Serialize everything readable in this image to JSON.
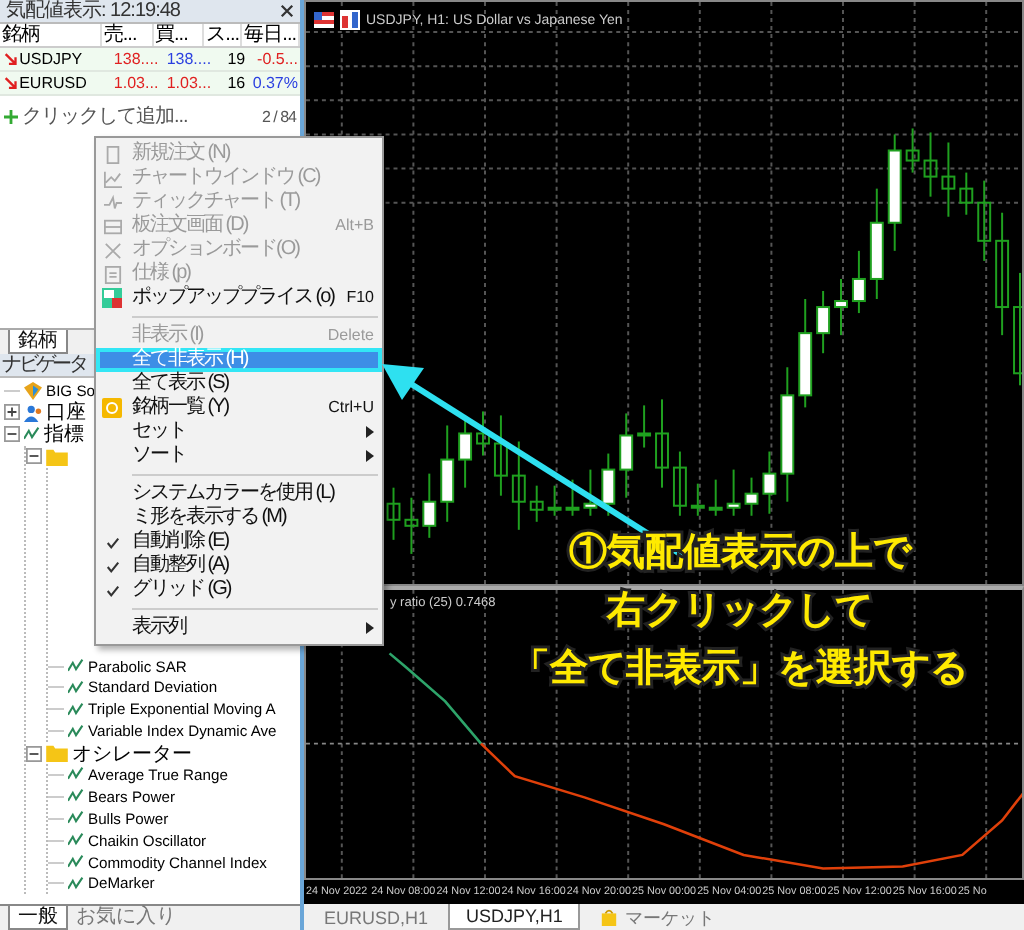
{
  "market_watch": {
    "title": "気配値表示: 12:19:48",
    "columns": [
      "銘柄",
      "売...",
      "買...",
      "ス...",
      "毎日..."
    ],
    "rows": [
      {
        "symbol": "USDJPY",
        "falling": true,
        "bid": "138....",
        "bid_up": false,
        "ask": "138....",
        "ask_up": true,
        "spread": "19",
        "change": "-0.5...",
        "change_up": false
      },
      {
        "symbol": "EURUSD",
        "falling": true,
        "bid": "1.03...",
        "bid_up": false,
        "ask": "1.03...",
        "ask_up": false,
        "spread": "16",
        "change": "0.37%",
        "change_up": true
      }
    ],
    "add_row": {
      "label": "クリックして追加...",
      "count": "2 / 84"
    },
    "tabs": [
      {
        "label": "銘柄",
        "selected": true
      }
    ]
  },
  "navigator": {
    "title": "ナビゲータ",
    "tree": [
      {
        "kind": "broker",
        "label": "BIG So"
      },
      {
        "kind": "account",
        "label": "口座",
        "expanded": false
      },
      {
        "kind": "indicators",
        "label": "指標",
        "expanded": true,
        "children": [
          {
            "kind": "folder",
            "expanded": true,
            "children": [
              {
                "kind": "indicator",
                "label": "Parabolic SAR"
              },
              {
                "kind": "indicator",
                "label": "Standard Deviation"
              },
              {
                "kind": "indicator",
                "label": "Triple Exponential Moving A"
              },
              {
                "kind": "indicator",
                "label": "Variable Index Dynamic Ave"
              }
            ]
          },
          {
            "kind": "folder",
            "label": "オシレーター",
            "expanded": true,
            "children": [
              {
                "kind": "indicator",
                "label": "Average True Range"
              },
              {
                "kind": "indicator",
                "label": "Bears Power"
              },
              {
                "kind": "indicator",
                "label": "Bulls Power"
              },
              {
                "kind": "indicator",
                "label": "Chaikin Oscillator"
              },
              {
                "kind": "indicator",
                "label": "Commodity Channel Index"
              },
              {
                "kind": "indicator",
                "label": "DeMarker"
              }
            ]
          }
        ]
      }
    ],
    "tabs": [
      {
        "label": "一般",
        "selected": true
      },
      {
        "label": "お気に入り",
        "selected": false
      }
    ]
  },
  "context_menu": [
    {
      "kind": "item",
      "label": "新規注文 (N)",
      "disabled": true
    },
    {
      "kind": "item",
      "label": "チャートウインドウ (C)",
      "disabled": true
    },
    {
      "kind": "item",
      "label": "ティックチャート (T)",
      "disabled": true
    },
    {
      "kind": "item",
      "label": "板注文画面 (D)",
      "shortcut": "Alt+B",
      "disabled": true
    },
    {
      "kind": "item",
      "label": "オプションボード(O)",
      "disabled": true
    },
    {
      "kind": "item",
      "label": "仕様 (p)",
      "disabled": true
    },
    {
      "kind": "item",
      "label": "ポップアッププライス (o)",
      "shortcut": "F10",
      "disabled": false
    },
    {
      "kind": "separator"
    },
    {
      "kind": "item",
      "label": "非表示 (I)",
      "shortcut": "Delete",
      "disabled": true
    },
    {
      "kind": "item",
      "label": "全て非表示 (H)",
      "disabled": false,
      "selected": true
    },
    {
      "kind": "item",
      "label": "全て表示 (S)",
      "disabled": false
    },
    {
      "kind": "item",
      "label": "銘柄一覧 (Y)",
      "shortcut": "Ctrl+U",
      "disabled": false
    },
    {
      "kind": "item",
      "label": "セット",
      "disabled": false,
      "submenu": true
    },
    {
      "kind": "item",
      "label": "ソート",
      "disabled": false,
      "submenu": true
    },
    {
      "kind": "separator"
    },
    {
      "kind": "item",
      "label": "システムカラーを使用 (L)",
      "disabled": false,
      "checked": false
    },
    {
      "kind": "item",
      "label": "ミ形を表示する (M)",
      "disabled": false,
      "checked": false
    },
    {
      "kind": "item",
      "label": "自動削除 (E)",
      "disabled": false,
      "checked": true
    },
    {
      "kind": "item",
      "label": "自動整列 (A)",
      "disabled": false,
      "checked": true
    },
    {
      "kind": "item",
      "label": "グリッド (G)",
      "disabled": false,
      "checked": true
    },
    {
      "kind": "separator"
    },
    {
      "kind": "item",
      "label": "表示列",
      "disabled": false,
      "submenu": true
    }
  ],
  "chart": {
    "title": "USDJPY, H1:  US Dollar vs Japanese Yen",
    "indicator_label": "y ratio (25) 0.7468",
    "time_labels": [
      "24 Nov 2022",
      "24 Nov 08:00",
      "24 Nov 12:00",
      "24 Nov 16:00",
      "24 Nov 20:00",
      "25 Nov 00:00",
      "25 Nov 04:00",
      "25 Nov 08:00",
      "25 Nov 12:00",
      "25 Nov 16:00",
      "25 No"
    ],
    "tabs": [
      {
        "label": "EURUSD,H1",
        "selected": false,
        "kind": "chart"
      },
      {
        "label": "USDJPY,H1",
        "selected": true,
        "kind": "chart"
      },
      {
        "label": "マーケット",
        "selected": false,
        "kind": "market"
      }
    ]
  },
  "annotation": {
    "lines": [
      "①気配値表示の上で",
      "右クリックして",
      "「全て非表示」を選択する"
    ]
  }
}
